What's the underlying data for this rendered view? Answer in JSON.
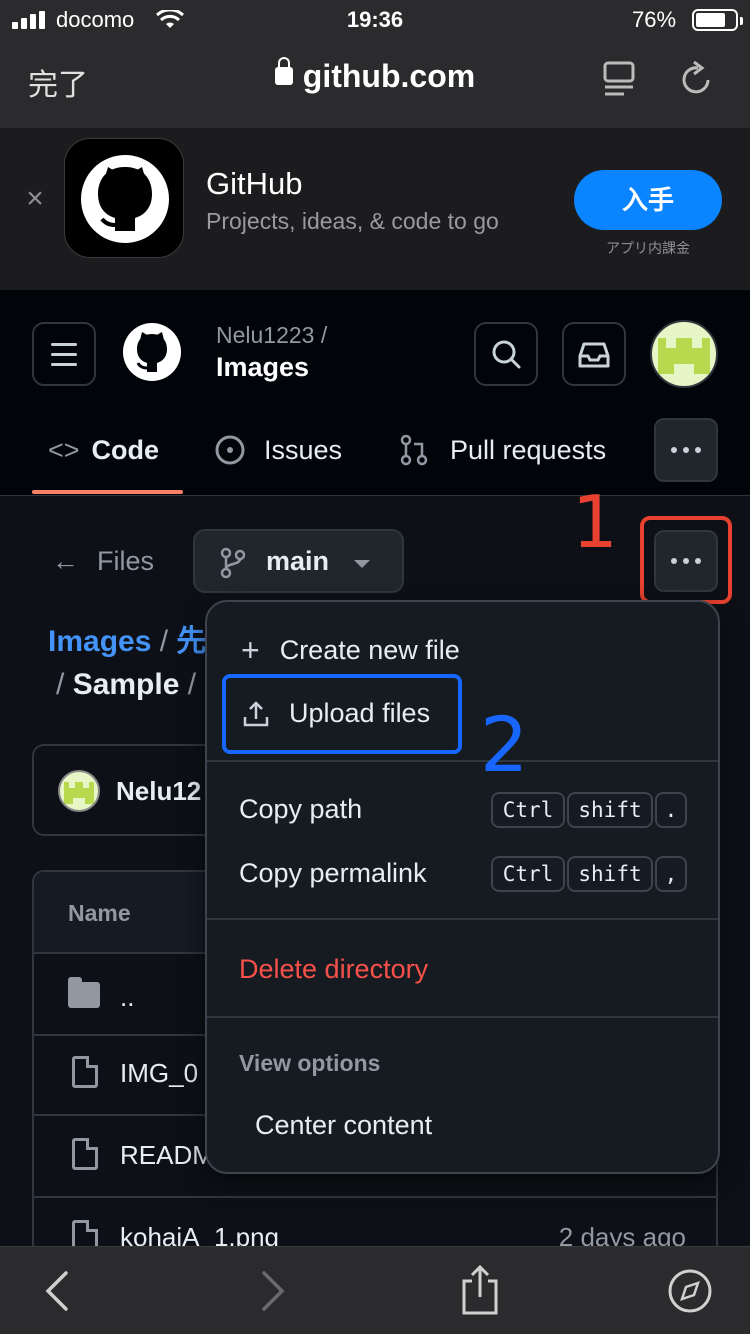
{
  "status": {
    "carrier": "docomo",
    "time": "19:36",
    "battery": "76%",
    "battery_level": 0.76
  },
  "safari": {
    "done": "完了",
    "url": "github.com"
  },
  "banner": {
    "title": "GitHub",
    "subtitle": "Projects, ideas, & code to go",
    "get": "入手",
    "iap": "アプリ内課金"
  },
  "repo": {
    "owner": "Nelu1223 /",
    "name": "Images"
  },
  "tabs": [
    {
      "label": "Code",
      "icon": "code-icon"
    },
    {
      "label": "Issues",
      "icon": "issue-icon"
    },
    {
      "label": "Pull requests",
      "icon": "pull-request-icon"
    }
  ],
  "files": {
    "back": "Files",
    "branch": "main"
  },
  "breadcrumb": {
    "root": "Images",
    "sep": "/",
    "partial": "先",
    "sample": "Sample"
  },
  "annotations": {
    "step1": "1",
    "step2": "2",
    "step1_color": "#e8412f",
    "step2_color": "#1766ff"
  },
  "commit": {
    "user": "Nelu12"
  },
  "table": {
    "header": "Name",
    "rows": [
      {
        "name": "..",
        "type": "folder",
        "date": ""
      },
      {
        "name": "IMG_0",
        "type": "file",
        "date": ""
      },
      {
        "name": "READM",
        "type": "file",
        "date": ""
      },
      {
        "name": "kohaiA_1.png",
        "type": "file",
        "date": "2 days ago"
      }
    ]
  },
  "menu": {
    "create": "Create new file",
    "upload": "Upload files",
    "copy_path": "Copy path",
    "copy_permalink": "Copy permalink",
    "kbd_ctrl": "Ctrl",
    "kbd_shift": "shift",
    "kbd_period": ".",
    "kbd_comma": ",",
    "delete": "Delete directory",
    "view_options": "View options",
    "center": "Center content"
  },
  "colors": {
    "accent_link": "#4493f8",
    "danger": "#f85149",
    "ios_blue": "#0a84ff"
  }
}
